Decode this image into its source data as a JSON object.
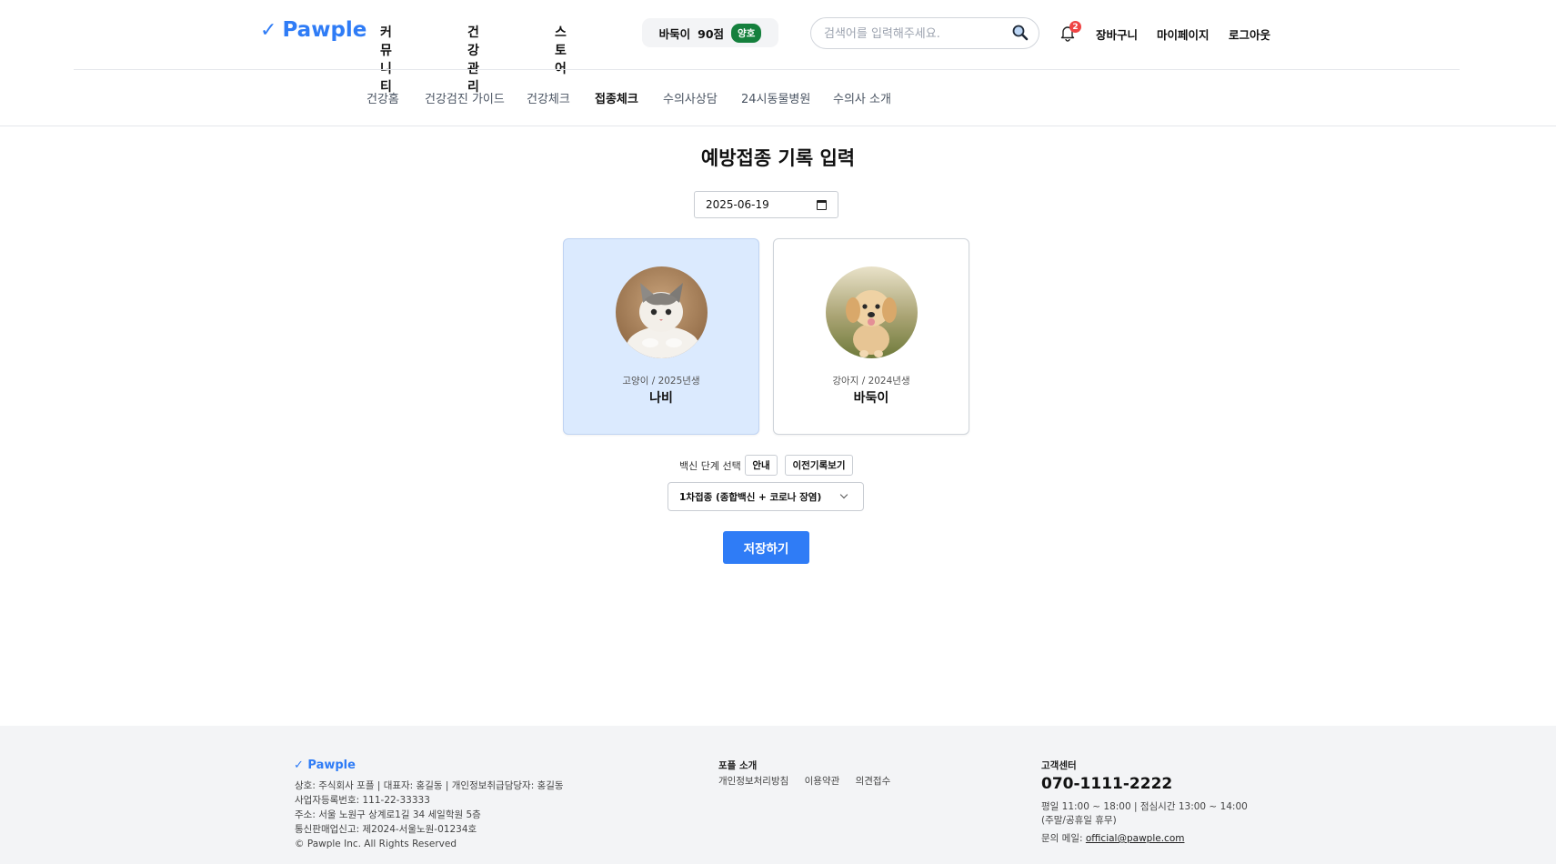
{
  "header": {
    "logo_check": "✓",
    "logo_text": "Pawple",
    "nav": [
      "커뮤니티",
      "건강관리",
      "스토어"
    ],
    "pet_score": {
      "name": "바둑이",
      "score": "90점",
      "badge": "양호",
      "badge_color": "#15803d"
    },
    "search": {
      "placeholder": "검색어를 입력해주세요.",
      "value": ""
    },
    "notification_count": "2",
    "links": {
      "cart": "장바구니",
      "mypage": "마이페이지",
      "logout": "로그아웃"
    }
  },
  "subnav": {
    "items": [
      "건강홈",
      "건강검진 가이드",
      "건강체크",
      "접종체크",
      "수의사상담",
      "24시동물병원",
      "수의사 소개"
    ],
    "active": "접종체크"
  },
  "main": {
    "title": "예방접종 기록 입력",
    "date": "2025-06-19",
    "pets": [
      {
        "meta": "고양이 / 2025년생",
        "name": "나비",
        "selected": true,
        "photo_icon": "cat-photo"
      },
      {
        "meta": "강아지 / 2024년생",
        "name": "바둑이",
        "selected": false,
        "photo_icon": "puppy-photo"
      }
    ],
    "vaccine_label": "백신 단계 선택",
    "info_button": "안내",
    "history_button": "이전기록보기",
    "vaccine_selected": "1차접종 (종합백신 + 코로나 장염)",
    "save_button": "저장하기"
  },
  "footer": {
    "logo": "✓ Pawple",
    "company_lines": [
      "상호: 주식회사 포플 | 대표자: 홍길동 | 개인정보취급담당자: 홍길동",
      "사업자등록번호: 111-22-33333",
      "주소: 서울 노원구 상계로1길 34 세일학원 5층",
      "통신판매업신고: 제2024-서울노원-01234호",
      "© Pawple Inc. All Rights Reserved"
    ],
    "about_title": "포플 소개",
    "links": [
      "개인정보처리방침",
      "이용약관",
      "의견접수"
    ],
    "cs_title": "고객센터",
    "phone": "070-1111-2222",
    "hours": [
      "평일 11:00 ~ 18:00 | 점심시간 13:00 ~ 14:00",
      "(주말/공휴일 휴무)"
    ],
    "mail_label": "문의 메일:",
    "mail": "official@pawple.com"
  },
  "colors": {
    "accent": "#2f7cf6",
    "selected_card": "#dbeafe",
    "footer_bg": "#f3f4f6",
    "badge_red": "#ef4444"
  }
}
